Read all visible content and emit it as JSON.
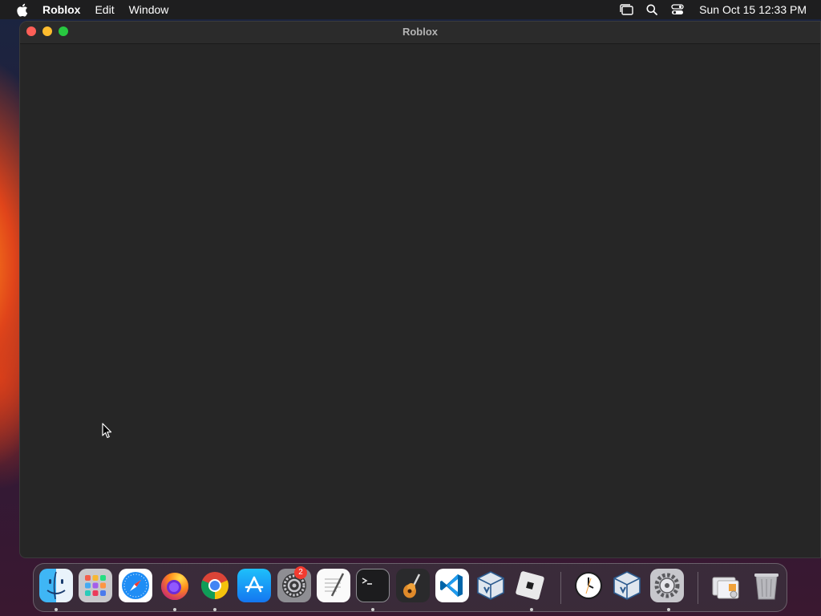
{
  "menubar": {
    "app_name": "Roblox",
    "menus": [
      "Edit",
      "Window"
    ],
    "clock": "Sun Oct 15  12:33 PM",
    "status_icons": [
      "stage-manager-icon",
      "search-icon",
      "control-center-icon"
    ]
  },
  "window": {
    "title": "Roblox"
  },
  "dock": {
    "apps": [
      {
        "name": "Finder",
        "icon": "finder-icon",
        "running": true
      },
      {
        "name": "Launchpad",
        "icon": "launchpad-icon",
        "running": false
      },
      {
        "name": "Safari",
        "icon": "safari-icon",
        "running": false
      },
      {
        "name": "Firefox",
        "icon": "firefox-icon",
        "running": true
      },
      {
        "name": "Chrome",
        "icon": "chrome-icon",
        "running": true
      },
      {
        "name": "App Store",
        "icon": "app-store-icon",
        "running": false
      },
      {
        "name": "System Settings",
        "icon": "system-settings-icon",
        "running": false,
        "badge": "2"
      },
      {
        "name": "TextEdit",
        "icon": "textedit-icon",
        "running": false
      },
      {
        "name": "Terminal",
        "icon": "terminal-icon",
        "running": true
      },
      {
        "name": "GarageBand",
        "icon": "garageband-icon",
        "running": false
      },
      {
        "name": "Visual Studio Code",
        "icon": "vscode-icon",
        "running": false
      },
      {
        "name": "VirtualBox",
        "icon": "virtualbox-icon",
        "running": false
      },
      {
        "name": "Roblox",
        "icon": "roblox-icon",
        "running": true
      },
      {
        "name": "Clock",
        "icon": "clock-icon",
        "running": false
      },
      {
        "name": "VirtualBox VM",
        "icon": "virtualbox-vm-icon",
        "running": false
      },
      {
        "name": "Settings",
        "icon": "settings-gear-icon",
        "running": true
      },
      {
        "name": "Downloads",
        "icon": "downloads-stack-icon",
        "running": false
      },
      {
        "name": "Trash",
        "icon": "trash-icon",
        "running": false
      }
    ]
  }
}
